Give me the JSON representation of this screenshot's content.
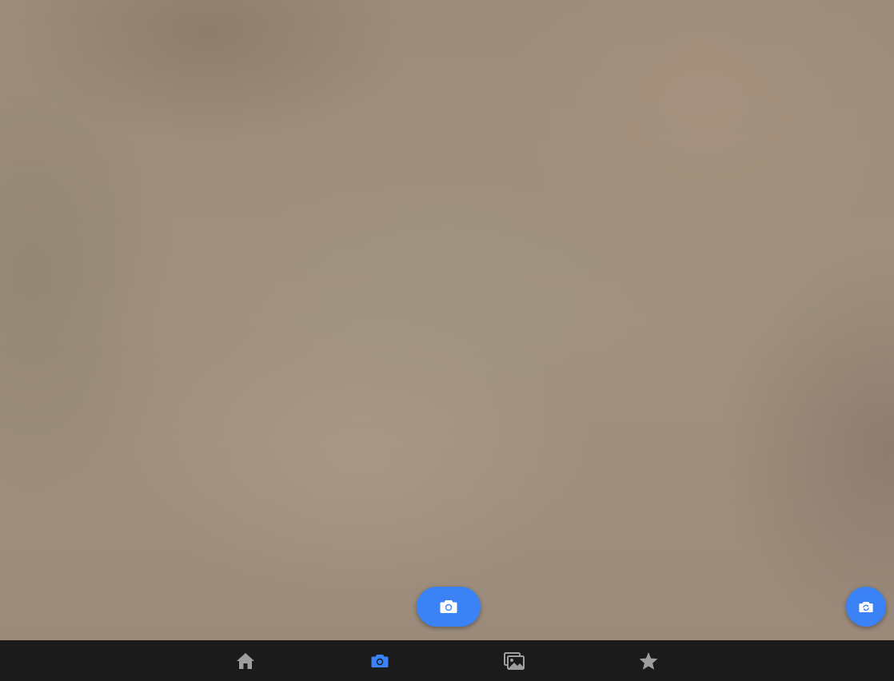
{
  "viewfinder": {
    "description_free": true
  },
  "controls": {
    "capture_icon": "camera-icon",
    "switch_icon": "camera-switch-icon"
  },
  "bottom_nav": {
    "items": [
      {
        "icon": "home-icon",
        "active": false
      },
      {
        "icon": "camera-icon",
        "active": true
      },
      {
        "icon": "gallery-icon",
        "active": false
      },
      {
        "icon": "star-icon",
        "active": false
      }
    ],
    "active_color": "#3b82f6",
    "inactive_color": "#9e9e9e"
  },
  "colors": {
    "accent": "#3b82f6",
    "nav_background": "#1b1b1b"
  }
}
